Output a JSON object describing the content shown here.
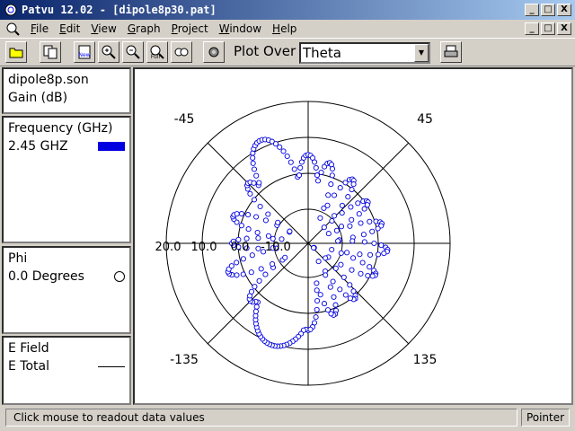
{
  "window": {
    "title": "Patvu 12.02 - [dipole8p30.pat]",
    "minimize": "_",
    "maximize": "□",
    "close": "X"
  },
  "menu": [
    {
      "label": "File",
      "key": "F",
      "rest": "ile"
    },
    {
      "label": "Edit",
      "key": "E",
      "rest": "dit"
    },
    {
      "label": "View",
      "key": "V",
      "rest": "iew"
    },
    {
      "label": "Graph",
      "key": "G",
      "rest": "raph"
    },
    {
      "label": "Project",
      "key": "P",
      "rest": "roject"
    },
    {
      "label": "Window",
      "key": "W",
      "rest": "indow"
    },
    {
      "label": "Help",
      "key": "H",
      "rest": "elp"
    }
  ],
  "toolbar": {
    "plot_over_label": "Plot Over",
    "plot_over_value": "Theta",
    "icons": [
      "open-icon",
      "copy-icon",
      "new-icon",
      "zoom-in-icon",
      "zoom-out-icon",
      "zoom-full-icon",
      "pan-icon",
      "settings-icon",
      "print-icon"
    ]
  },
  "panels": {
    "file": {
      "name": "dipole8p.son",
      "quantity": "Gain (dB)"
    },
    "frequency": {
      "header": "Frequency (GHz)",
      "value": "2.45 GHZ",
      "color": "#0000e0"
    },
    "phi": {
      "header": "Phi",
      "value": "0.0 Degrees"
    },
    "field": {
      "header": "E Field",
      "value": "E Total"
    }
  },
  "chart_data": {
    "type": "polar",
    "radial_labels": [
      "20.0",
      "10.0",
      "0.0",
      "-10.0"
    ],
    "angle_labels": {
      "top_left": "-45",
      "top_right": "45",
      "bottom_left": "-135",
      "bottom_right": "135"
    },
    "marker": "open-circle",
    "series": [
      {
        "color": "#0000e0",
        "lobes": [
          {
            "angle": -160,
            "gain": 10.5,
            "width": 22
          },
          {
            "angle": -135,
            "gain": 3.0,
            "width": 10
          },
          {
            "angle": -110,
            "gain": 4.0,
            "width": 9
          },
          {
            "angle": -90,
            "gain": 1.5,
            "width": 7
          },
          {
            "angle": -70,
            "gain": 2.5,
            "width": 9
          },
          {
            "angle": -45,
            "gain": 4.0,
            "width": 9
          },
          {
            "angle": -25,
            "gain": 12.0,
            "width": 14
          },
          {
            "angle": 0,
            "gain": 5.0,
            "width": 10
          },
          {
            "angle": 15,
            "gain": 3.5,
            "width": 8
          },
          {
            "angle": 35,
            "gain": 2.0,
            "width": 8
          },
          {
            "angle": 55,
            "gain": 0.5,
            "width": 8
          },
          {
            "angle": 75,
            "gain": 1.5,
            "width": 8
          },
          {
            "angle": 95,
            "gain": 2.5,
            "width": 8
          },
          {
            "angle": 115,
            "gain": 1.0,
            "width": 8
          },
          {
            "angle": 140,
            "gain": 0.5,
            "width": 8
          },
          {
            "angle": 160,
            "gain": 1.5,
            "width": 8
          },
          {
            "angle": 180,
            "gain": 4.5,
            "width": 10
          }
        ]
      }
    ]
  },
  "status": {
    "message": "Click mouse to readout data values",
    "mode": "Pointer"
  }
}
